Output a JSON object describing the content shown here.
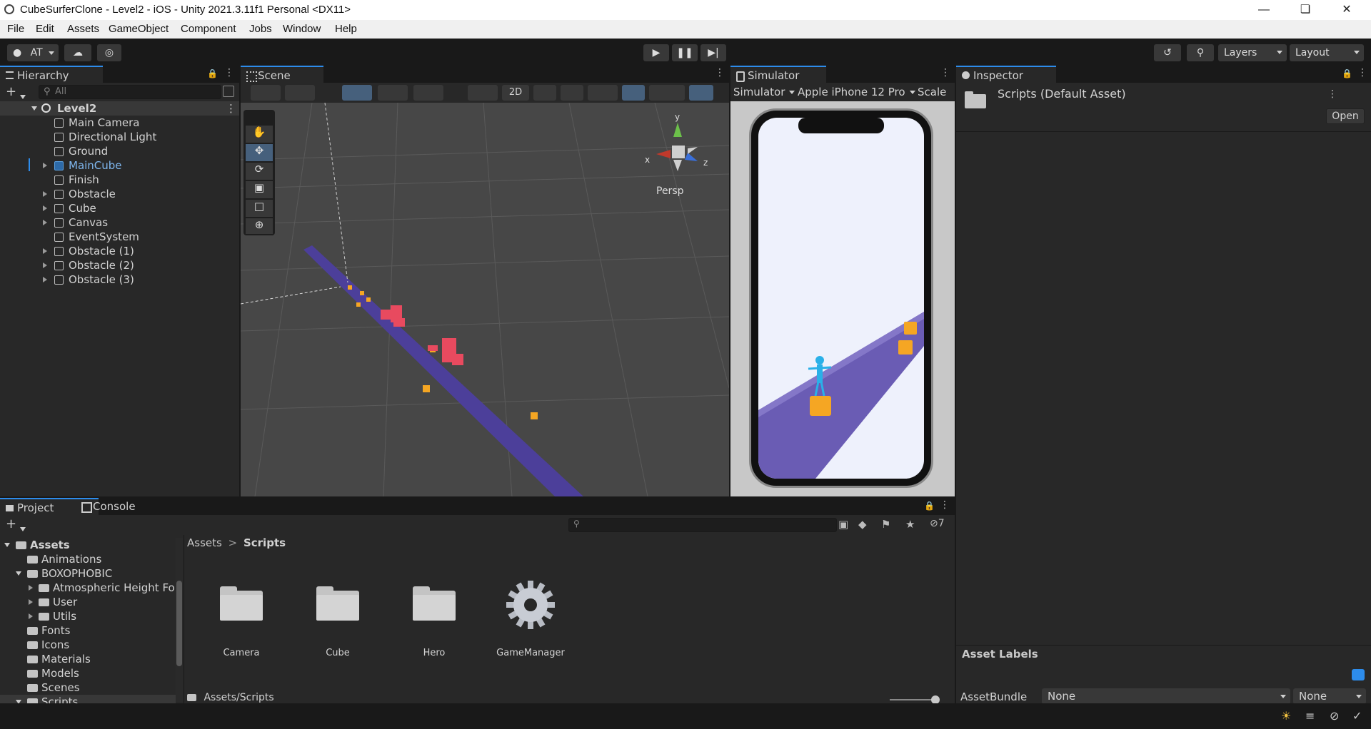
{
  "window": {
    "title": "CubeSurferClone - Level2 - iOS - Unity 2021.3.11f1 Personal <DX11>"
  },
  "menu": [
    "File",
    "Edit",
    "Assets",
    "GameObject",
    "Component",
    "Jobs",
    "Window",
    "Help"
  ],
  "toolbar": {
    "account": "AT",
    "layers_label": "Layers",
    "layout_label": "Layout"
  },
  "hierarchy": {
    "tab": "Hierarchy",
    "search_placeholder": "All",
    "scene": "Level2",
    "items": [
      {
        "label": "Main Camera",
        "expandable": false,
        "selected": false
      },
      {
        "label": "Directional Light",
        "expandable": false,
        "selected": false
      },
      {
        "label": "Ground",
        "expandable": false,
        "selected": false
      },
      {
        "label": "MainCube",
        "expandable": true,
        "selected": true
      },
      {
        "label": "Finish",
        "expandable": false,
        "selected": false
      },
      {
        "label": "Obstacle",
        "expandable": true,
        "selected": false
      },
      {
        "label": "Cube",
        "expandable": true,
        "selected": false
      },
      {
        "label": "Canvas",
        "expandable": true,
        "selected": false
      },
      {
        "label": "EventSystem",
        "expandable": false,
        "selected": false
      },
      {
        "label": "Obstacle (1)",
        "expandable": true,
        "selected": false
      },
      {
        "label": "Obstacle (2)",
        "expandable": true,
        "selected": false
      },
      {
        "label": "Obstacle (3)",
        "expandable": true,
        "selected": false
      }
    ]
  },
  "scene": {
    "tab": "Scene",
    "mode_2d": "2D",
    "persp": "Persp",
    "axes": {
      "x": "x",
      "y": "y",
      "z": "z"
    }
  },
  "simulator": {
    "tab": "Simulator",
    "mode": "Simulator",
    "device": "Apple iPhone 12 Pro",
    "scale": "Scale"
  },
  "inspector": {
    "tab": "Inspector",
    "asset": "Scripts (Default Asset)",
    "open_button": "Open",
    "asset_labels": "Asset Labels",
    "assetbundle_label": "AssetBundle",
    "bundle_value": "None",
    "variant_value": "None"
  },
  "project": {
    "tabs": [
      "Project",
      "Console"
    ],
    "hidden_count": "7",
    "breadcrumb": [
      "Assets",
      "Scripts"
    ],
    "tree": [
      {
        "label": "Assets",
        "level": 0,
        "expanded": true,
        "bold": true
      },
      {
        "label": "Animations",
        "level": 1
      },
      {
        "label": "BOXOPHOBIC",
        "level": 1,
        "expanded": true
      },
      {
        "label": "Atmospheric Height Fo",
        "level": 2,
        "collapsed": true
      },
      {
        "label": "User",
        "level": 2,
        "collapsed": true
      },
      {
        "label": "Utils",
        "level": 2,
        "collapsed": true
      },
      {
        "label": "Fonts",
        "level": 1
      },
      {
        "label": "Icons",
        "level": 1
      },
      {
        "label": "Materials",
        "level": 1
      },
      {
        "label": "Models",
        "level": 1
      },
      {
        "label": "Scenes",
        "level": 1
      },
      {
        "label": "Scripts",
        "level": 1,
        "expanded": true,
        "selected": true
      }
    ],
    "assets": [
      {
        "label": "Camera",
        "kind": "folder"
      },
      {
        "label": "Cube",
        "kind": "folder"
      },
      {
        "label": "Hero",
        "kind": "folder"
      },
      {
        "label": "GameManager",
        "kind": "gear"
      }
    ],
    "path": "Assets/Scripts"
  },
  "colors": {
    "accent": "#2d8ceb",
    "panel": "#282828",
    "dark": "#191919",
    "selection": "#2c5d87",
    "road": "#5b4e9c",
    "cube": "#f5a623",
    "obstacle": "#e84a5f"
  }
}
